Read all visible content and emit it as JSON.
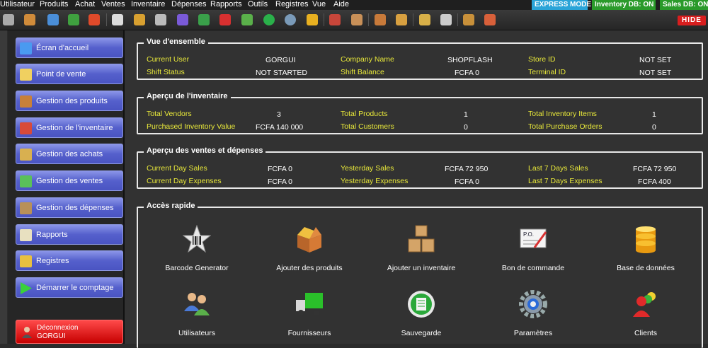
{
  "menu": [
    "Utilisateur",
    "Produits",
    "Achat",
    "Ventes",
    "Inventaire",
    "Dépenses",
    "Rapports",
    "Outils",
    "Registres",
    "Vue",
    "Aide"
  ],
  "status": {
    "express": "EXPRESS MODE",
    "inventory_db": "Inventory DB: ON",
    "sales_db": "Sales DB: ON"
  },
  "toolbar": {
    "hide_label": "HIDE"
  },
  "sidebar": {
    "items": [
      {
        "label": "Écran d'accueil",
        "icon": "home-icon"
      },
      {
        "label": "Point de vente",
        "icon": "pos-icon"
      },
      {
        "label": "Gestion des produits",
        "icon": "box-icon"
      },
      {
        "label": "Gestion de l'inventaire",
        "icon": "cubes-icon"
      },
      {
        "label": "Gestion des achats",
        "icon": "notepad-icon"
      },
      {
        "label": "Gestion des ventes",
        "icon": "chart-up-icon"
      },
      {
        "label": "Gestion des dépenses",
        "icon": "wallet-icon"
      },
      {
        "label": "Rapports",
        "icon": "report-icon"
      },
      {
        "label": "Registres",
        "icon": "register-icon"
      },
      {
        "label": "Démarrer le comptage",
        "icon": "play-icon"
      }
    ],
    "logout_line1": "Déconnexion",
    "logout_user": "GORGUI"
  },
  "overview": {
    "title": "Vue d'ensemble",
    "current_user_label": "Current User",
    "current_user": "GORGUI",
    "company_label": "Company Name",
    "company": "SHOPFLASH",
    "store_label": "Store ID",
    "store": "NOT SET",
    "shift_status_label": "Shift Status",
    "shift_status": "NOT STARTED",
    "shift_balance_label": "Shift Balance",
    "shift_balance": "FCFA 0",
    "terminal_label": "Terminal ID",
    "terminal": "NOT SET"
  },
  "inventory": {
    "title": "Aperçu de l'inventaire",
    "vendors_label": "Total Vendors",
    "vendors": "3",
    "products_label": "Total Products",
    "products": "1",
    "items_label": "Total Inventory Items",
    "items": "1",
    "purchased_label": "Purchased Inventory Value",
    "purchased": "FCFA 140 000",
    "customers_label": "Total Customers",
    "customers": "0",
    "orders_label": "Total Purchase Orders",
    "orders": "0"
  },
  "sales": {
    "title": "Aperçu des ventes et dépenses",
    "cur_sales_label": "Current Day Sales",
    "cur_sales": "FCFA 0",
    "yest_sales_label": "Yesterday Sales",
    "yest_sales": "FCFA 72 950",
    "week_sales_label": "Last 7 Days Sales",
    "week_sales": "FCFA 72 950",
    "cur_exp_label": "Current Day Expenses",
    "cur_exp": "FCFA 0",
    "yest_exp_label": "Yesterday Expenses",
    "yest_exp": "FCFA 0",
    "week_exp_label": "Last 7 Days Expenses",
    "week_exp": "FCFA 400"
  },
  "quick": {
    "title": "Accès rapide",
    "items": [
      {
        "label": "Barcode Generator",
        "icon": "barcode-star-icon"
      },
      {
        "label": "Ajouter des produits",
        "icon": "open-box-icon"
      },
      {
        "label": "Ajouter un inventaire",
        "icon": "stacked-boxes-icon"
      },
      {
        "label": "Bon de commande",
        "icon": "purchase-order-icon"
      },
      {
        "label": "Base de données",
        "icon": "database-icon"
      },
      {
        "label": "Utilisateurs",
        "icon": "users-icon"
      },
      {
        "label": "Fournisseurs",
        "icon": "truck-icon"
      },
      {
        "label": "Sauvegarde",
        "icon": "backup-icon"
      },
      {
        "label": "Paramètres",
        "icon": "gear-icon"
      },
      {
        "label": "Clients",
        "icon": "clients-icon"
      }
    ]
  }
}
